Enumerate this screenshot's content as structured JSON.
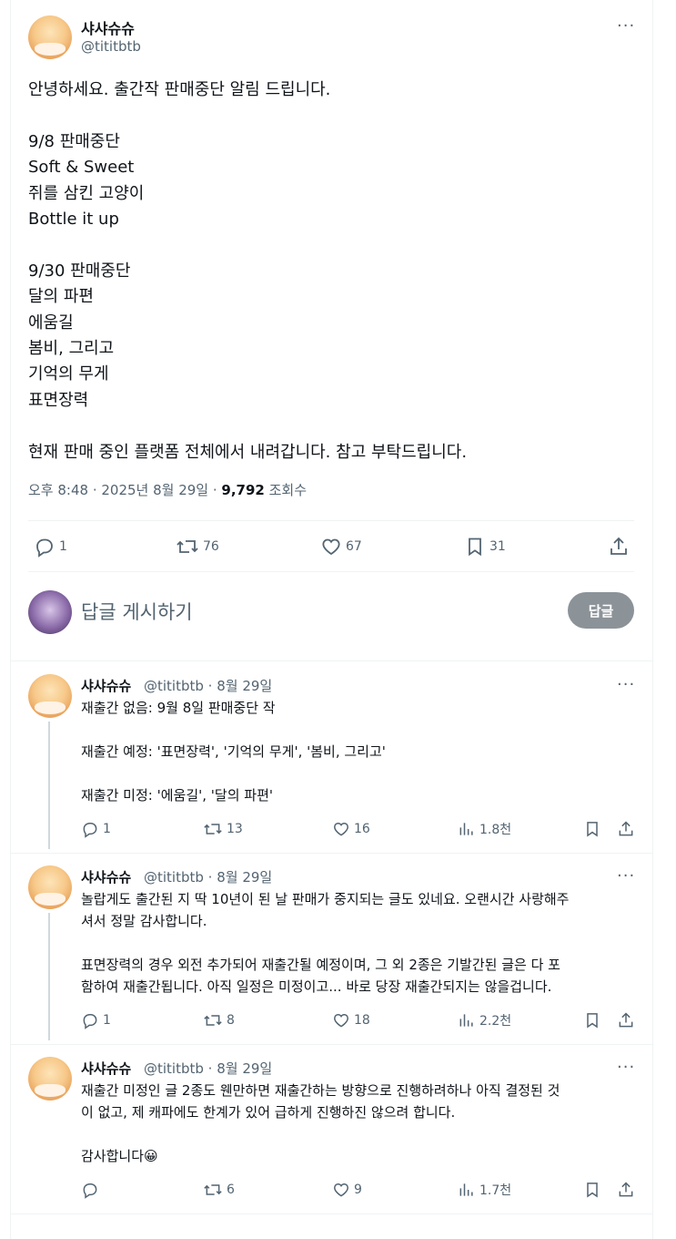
{
  "main_tweet": {
    "display_name": "샤샤슈슈",
    "handle": "@tititbtb",
    "more": "···",
    "text": "안녕하세요. 출간작 판매중단 알림 드립니다.\n\n9/8 판매중단\nSoft & Sweet\n쥐를 삼킨 고양이\nBottle it up\n\n9/30 판매중단\n달의 파편\n에움길\n봄비, 그리고\n기억의 무게\n표면장력\n\n현재 판매 중인 플랫폼 전체에서 내려갑니다. 참고 부탁드립니다.",
    "time": "오후 8:48 · 2025년 8월 29일 · ",
    "views_count": "9,792",
    "views_label": " 조회수",
    "actions": {
      "replies": "1",
      "retweets": "76",
      "likes": "67",
      "bookmarks": "31"
    }
  },
  "reply_box": {
    "placeholder": "답글 게시하기",
    "button": "답글"
  },
  "replies": [
    {
      "display_name": "샤샤슈슈",
      "handle_date": "@tititbtb · 8월 29일",
      "more": "···",
      "text": "재출간 없음: 9월 8일 판매중단 작\n\n재출간 예정: '표면장력', '기억의 무게', '봄비, 그리고'\n\n재출간 미정: '에움길', '달의 파편'",
      "actions": {
        "replies": "1",
        "retweets": "13",
        "likes": "16",
        "views": "1.8천"
      }
    },
    {
      "display_name": "샤샤슈슈",
      "handle_date": "@tititbtb · 8월 29일",
      "more": "···",
      "text": "놀랍게도 출간된 지 딱 10년이 된 날 판매가 중지되는 글도 있네요. 오랜시간 사랑해주\n셔서 정말 감사합니다.\n\n표면장력의 경우 외전 추가되어 재출간될 예정이며, 그 외 2종은 기발간된 글은 다 포\n함하여 재출간됩니다. 아직 일정은 미정이고... 바로 당장 재출간되지는 않을겁니다.",
      "actions": {
        "replies": "1",
        "retweets": "8",
        "likes": "18",
        "views": "2.2천"
      }
    },
    {
      "display_name": "샤샤슈슈",
      "handle_date": "@tititbtb · 8월 29일",
      "more": "···",
      "text": "재출간 미정인 글 2종도 웬만하면 재출간하는 방향으로 진행하려하나 아직 결정된 것\n이 없고, 제 캐파에도 한계가 있어 급하게 진행하진 않으려 합니다.\n\n감사합니다😀",
      "actions": {
        "replies": "",
        "retweets": "6",
        "likes": "9",
        "views": "1.7천"
      }
    }
  ]
}
